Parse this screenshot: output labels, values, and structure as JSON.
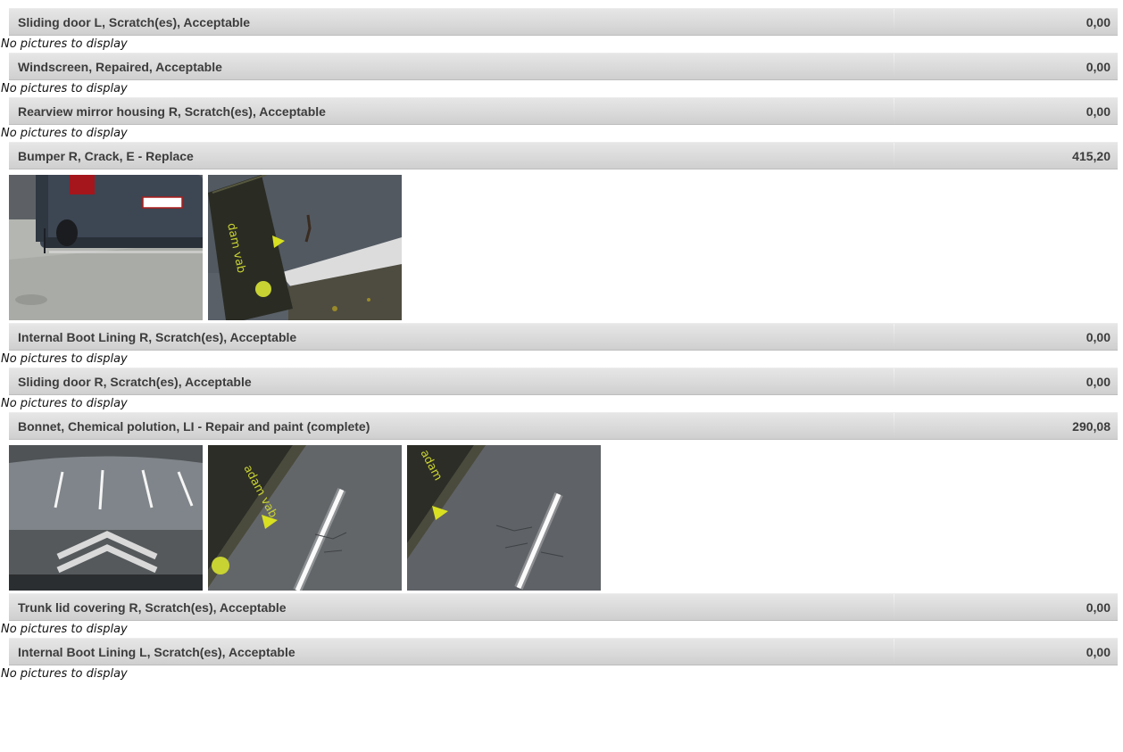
{
  "no_pictures_text": "No pictures to display",
  "items": [
    {
      "description": "Sliding door L, Scratch(es), Acceptable",
      "cost": "0,00",
      "photos": []
    },
    {
      "description": "Windscreen, Repaired, Acceptable",
      "cost": "0,00",
      "photos": []
    },
    {
      "description": "Rearview mirror housing R, Scratch(es), Acceptable",
      "cost": "0,00",
      "photos": []
    },
    {
      "description": "Bumper R, Crack, E - Replace",
      "cost": "415,20",
      "photos": [
        "rear-van-photo",
        "bumper-crack-closeup-photo"
      ]
    },
    {
      "description": "Internal Boot Lining R, Scratch(es), Acceptable",
      "cost": "0,00",
      "photos": []
    },
    {
      "description": "Sliding door R, Scratch(es), Acceptable",
      "cost": "0,00",
      "photos": []
    },
    {
      "description": "Bonnet, Chemical polution, LI - Repair and paint (complete)",
      "cost": "290,08",
      "photos": [
        "bonnet-front-photo",
        "bonnet-closeup-photo-1",
        "bonnet-closeup-photo-2"
      ]
    },
    {
      "description": "Trunk lid covering R, Scratch(es), Acceptable",
      "cost": "0,00",
      "photos": []
    },
    {
      "description": "Internal Boot Lining L, Scratch(es), Acceptable",
      "cost": "0,00",
      "photos": []
    }
  ]
}
